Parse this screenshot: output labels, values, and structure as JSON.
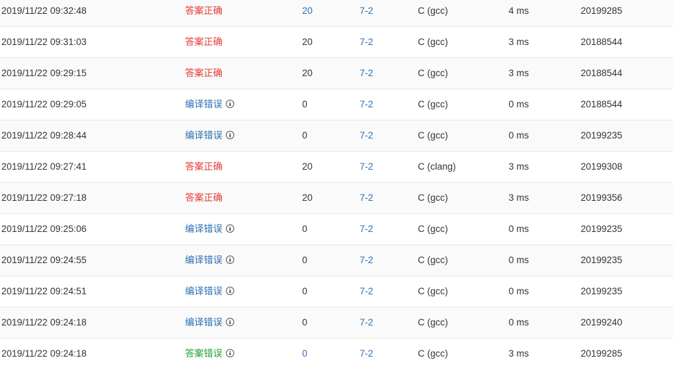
{
  "submissions": [
    {
      "time": "2019/11/22 09:32:48",
      "status": "答案正确",
      "status_type": "ac",
      "score": "20",
      "score_link": true,
      "problem": "7-2",
      "compiler": "C (gcc)",
      "time_used": "4 ms",
      "user": "20199285"
    },
    {
      "time": "2019/11/22 09:31:03",
      "status": "答案正确",
      "status_type": "ac",
      "score": "20",
      "score_link": false,
      "problem": "7-2",
      "compiler": "C (gcc)",
      "time_used": "3 ms",
      "user": "20188544"
    },
    {
      "time": "2019/11/22 09:29:15",
      "status": "答案正确",
      "status_type": "ac",
      "score": "20",
      "score_link": false,
      "problem": "7-2",
      "compiler": "C (gcc)",
      "time_used": "3 ms",
      "user": "20188544"
    },
    {
      "time": "2019/11/22 09:29:05",
      "status": "编译错误",
      "status_type": "ce",
      "score": "0",
      "score_link": false,
      "problem": "7-2",
      "compiler": "C (gcc)",
      "time_used": "0 ms",
      "user": "20188544"
    },
    {
      "time": "2019/11/22 09:28:44",
      "status": "编译错误",
      "status_type": "ce",
      "score": "0",
      "score_link": false,
      "problem": "7-2",
      "compiler": "C (gcc)",
      "time_used": "0 ms",
      "user": "20199235"
    },
    {
      "time": "2019/11/22 09:27:41",
      "status": "答案正确",
      "status_type": "ac",
      "score": "20",
      "score_link": false,
      "problem": "7-2",
      "compiler": "C (clang)",
      "time_used": "3 ms",
      "user": "20199308"
    },
    {
      "time": "2019/11/22 09:27:18",
      "status": "答案正确",
      "status_type": "ac",
      "score": "20",
      "score_link": false,
      "problem": "7-2",
      "compiler": "C (gcc)",
      "time_used": "3 ms",
      "user": "20199356"
    },
    {
      "time": "2019/11/22 09:25:06",
      "status": "编译错误",
      "status_type": "ce",
      "score": "0",
      "score_link": false,
      "problem": "7-2",
      "compiler": "C (gcc)",
      "time_used": "0 ms",
      "user": "20199235"
    },
    {
      "time": "2019/11/22 09:24:55",
      "status": "编译错误",
      "status_type": "ce",
      "score": "0",
      "score_link": false,
      "problem": "7-2",
      "compiler": "C (gcc)",
      "time_used": "0 ms",
      "user": "20199235"
    },
    {
      "time": "2019/11/22 09:24:51",
      "status": "编译错误",
      "status_type": "ce",
      "score": "0",
      "score_link": false,
      "problem": "7-2",
      "compiler": "C (gcc)",
      "time_used": "0 ms",
      "user": "20199235"
    },
    {
      "time": "2019/11/22 09:24:18",
      "status": "编译错误",
      "status_type": "ce",
      "score": "0",
      "score_link": false,
      "problem": "7-2",
      "compiler": "C (gcc)",
      "time_used": "0 ms",
      "user": "20199240"
    },
    {
      "time": "2019/11/22 09:24:18",
      "status": "答案错误",
      "status_type": "wa",
      "score": "0",
      "score_link": true,
      "problem": "7-2",
      "compiler": "C (gcc)",
      "time_used": "3 ms",
      "user": "20199285"
    }
  ],
  "status_colors": {
    "ac": "#e53935",
    "ce": "#2f6fb3",
    "wa": "#25a232"
  },
  "link_color": "#2f6fb3",
  "info_icon": "info-circle-icon"
}
